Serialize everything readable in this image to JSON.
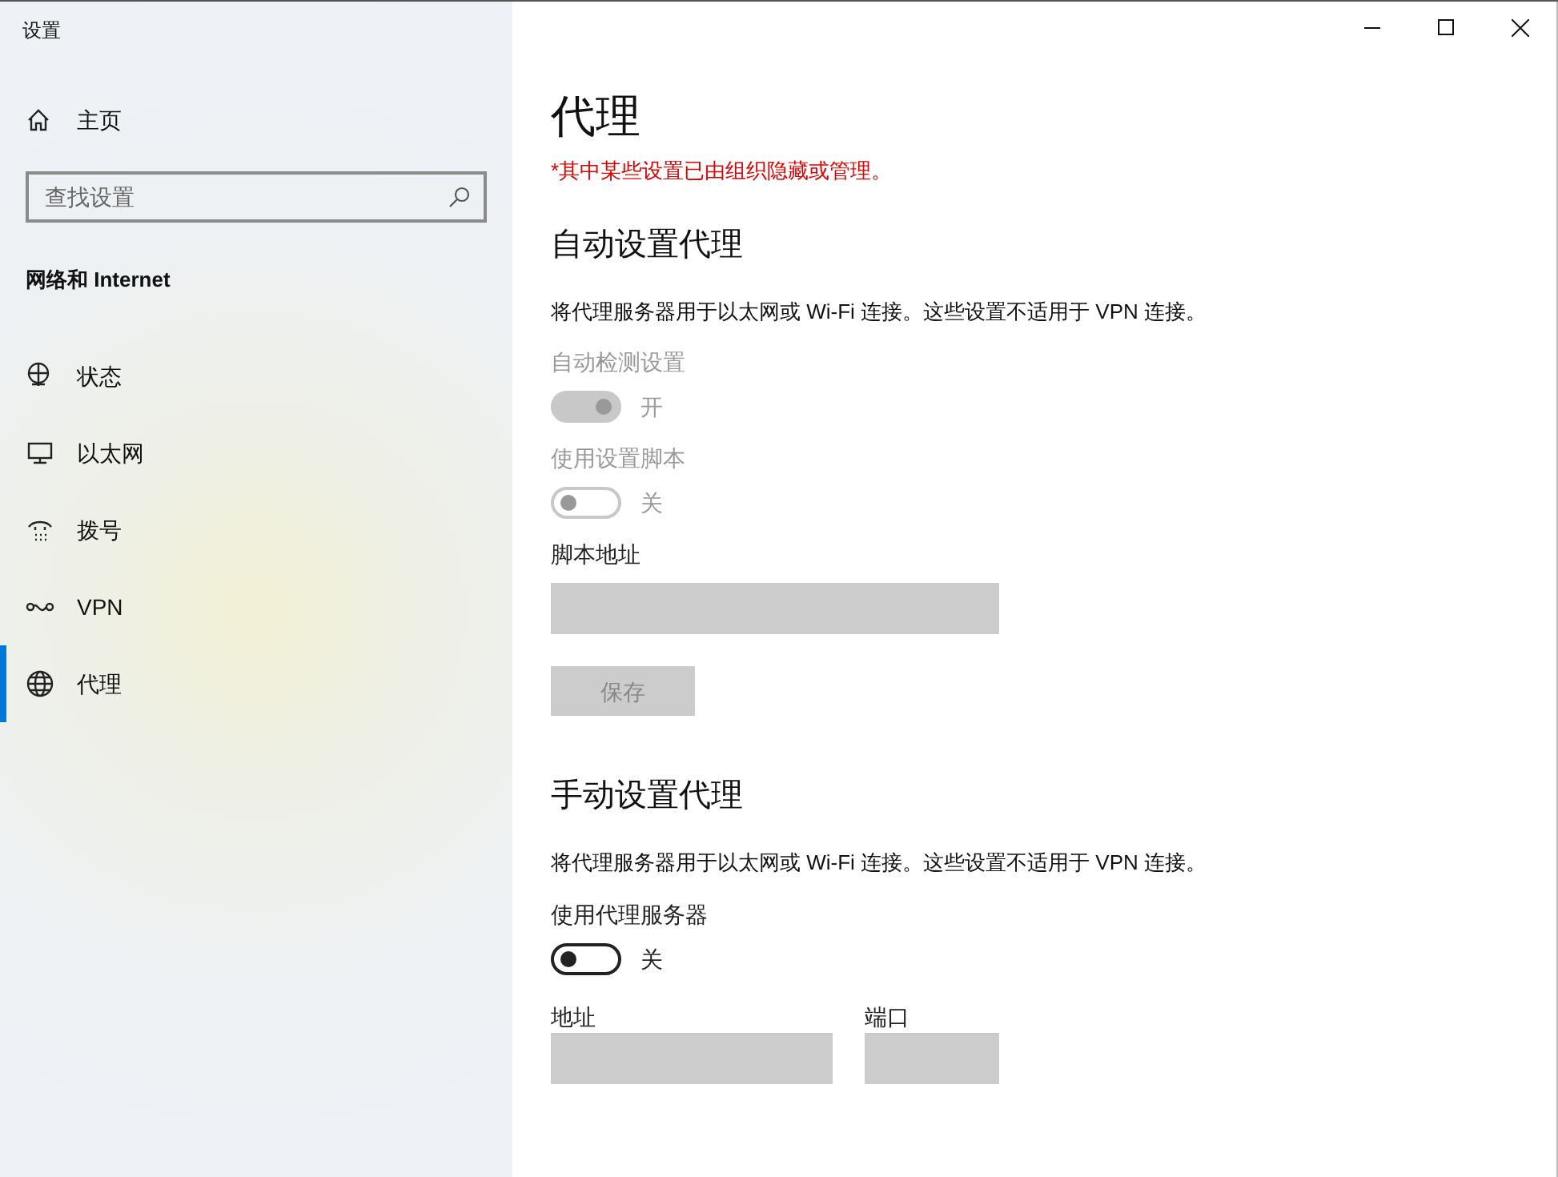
{
  "window": {
    "title": "设置"
  },
  "sidebar": {
    "home": "主页",
    "search": {
      "placeholder": "查找设置"
    },
    "category": "网络和 Internet",
    "items": [
      {
        "label": "状态",
        "kind": "status",
        "selected": false
      },
      {
        "label": "以太网",
        "kind": "ethernet",
        "selected": false
      },
      {
        "label": "拨号",
        "kind": "dialup",
        "selected": false
      },
      {
        "label": "VPN",
        "kind": "vpn",
        "selected": false
      },
      {
        "label": "代理",
        "kind": "proxy",
        "selected": true
      }
    ]
  },
  "page": {
    "title": "代理",
    "warning": "*其中某些设置已由组织隐藏或管理。",
    "sections": [
      {
        "heading": "自动设置代理",
        "description": "将代理服务器用于以太网或 Wi-Fi 连接。这些设置不适用于 VPN 连接。",
        "controls": [
          {
            "kind": "toggle",
            "label": "自动检测设置",
            "on": true,
            "disabled": true,
            "state_text": "开"
          },
          {
            "kind": "toggle",
            "label": "使用设置脚本",
            "on": false,
            "disabled": true,
            "state_text": "关"
          },
          {
            "kind": "field",
            "label": "脚本地址",
            "disabled": true
          },
          {
            "kind": "button",
            "label": "保存",
            "disabled": true
          }
        ]
      },
      {
        "heading": "手动设置代理",
        "description": "将代理服务器用于以太网或 Wi-Fi 连接。这些设置不适用于 VPN 连接。",
        "controls": [
          {
            "kind": "toggle",
            "label": "使用代理服务器",
            "on": false,
            "disabled": false,
            "state_text": "关"
          },
          {
            "kind": "field_pair",
            "fields": [
              {
                "label": "地址",
                "disabled": true
              },
              {
                "label": "端口",
                "disabled": true
              }
            ]
          }
        ]
      }
    ]
  }
}
